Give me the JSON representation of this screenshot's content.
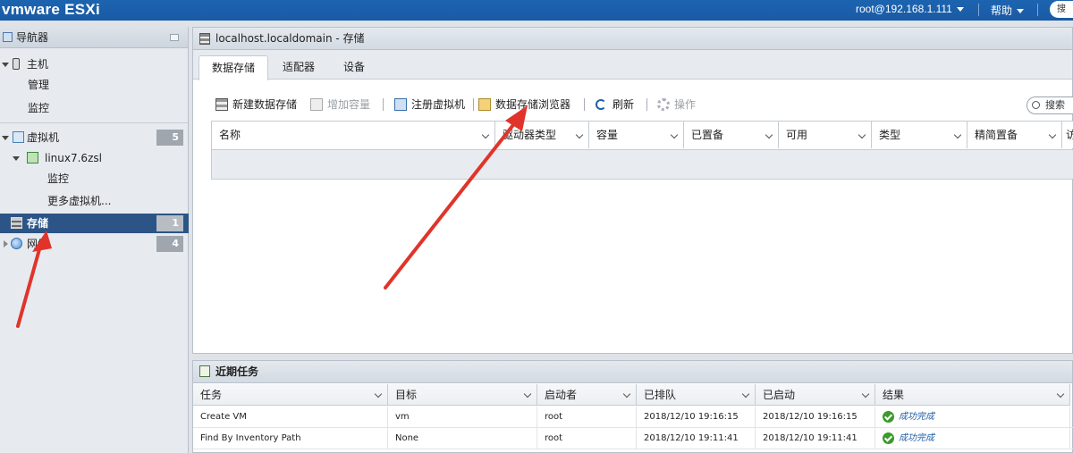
{
  "top": {
    "logo": "vmware ESXi",
    "user": "root@192.168.1.111",
    "help": "帮助",
    "search": "搜"
  },
  "nav": {
    "title": "导航器",
    "items": [
      {
        "label": "主机"
      },
      {
        "label": "管理"
      },
      {
        "label": "监控"
      },
      {
        "label": "虚拟机",
        "badge": "5"
      },
      {
        "label": "linux7.6zsl"
      },
      {
        "label": "监控"
      },
      {
        "label": "更多虚拟机..."
      },
      {
        "label": "存储",
        "badge": "1"
      },
      {
        "label": "网络",
        "badge": "4"
      }
    ]
  },
  "main": {
    "title": "localhost.localdomain - 存储",
    "tabs": [
      "数据存储",
      "适配器",
      "设备"
    ],
    "toolbar": [
      "新建数据存储",
      "增加容量",
      "注册虚拟机",
      "数据存储浏览器",
      "刷新",
      "操作"
    ],
    "search_placeholder": "搜索",
    "columns": [
      "名称",
      "驱动器类型",
      "容量",
      "已置备",
      "可用",
      "类型",
      "精简置备",
      "访"
    ]
  },
  "tasks": {
    "title": "近期任务",
    "columns": [
      "任务",
      "目标",
      "启动者",
      "已排队",
      "已启动",
      "结果"
    ],
    "rows": [
      {
        "task": "Create VM",
        "target": "vm",
        "initiator": "root",
        "queued": "2018/12/10 19:16:15",
        "started": "2018/12/10 19:16:15",
        "result": "成功完成"
      },
      {
        "task": "Find By Inventory Path",
        "target": "None",
        "initiator": "root",
        "queued": "2018/12/10 19:11:41",
        "started": "2018/12/10 19:11:41",
        "result": "成功完成"
      }
    ]
  },
  "colors": {
    "topbar": "#1a5aa5",
    "selected": "#2c5486",
    "arrow": "#e0342a",
    "success": "#3a9a2a"
  }
}
